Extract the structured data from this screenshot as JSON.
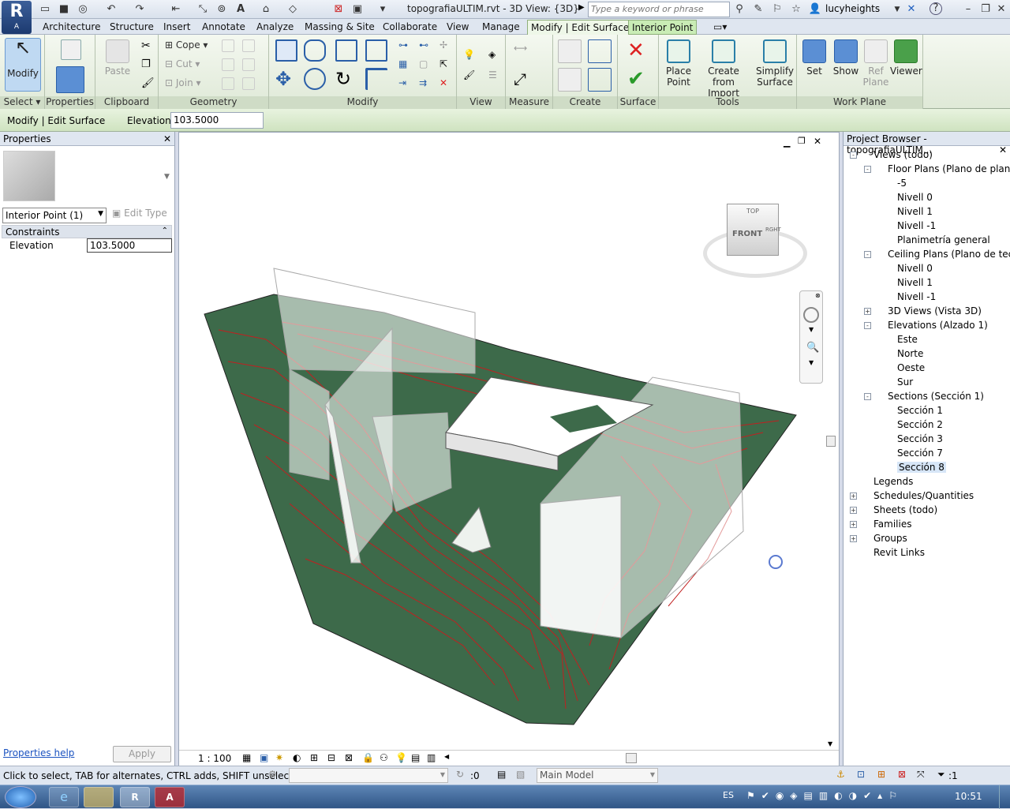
{
  "titlebar": {
    "title": "topografiaULTIM.rvt - 3D View: {3D}",
    "search_placeholder": "Type a keyword or phrase",
    "user": "lucyheights",
    "app_logo": "R",
    "app_logo_sub": "A"
  },
  "menu": {
    "tabs": [
      "Architecture",
      "Structure",
      "Insert",
      "Annotate",
      "Analyze",
      "Massing & Site",
      "Collaborate",
      "View",
      "Manage"
    ],
    "active_tab": "Modify | Edit Surface",
    "context_tab": "Interior Point"
  },
  "ribbon": {
    "panels": {
      "select": "Select",
      "properties": "Properties",
      "clipboard": "Clipboard",
      "geometry": "Geometry",
      "modify": "Modify",
      "view": "View",
      "measure": "Measure",
      "create": "Create",
      "surface": "Surface",
      "tools": "Tools",
      "workplane": "Work Plane"
    },
    "buttons": {
      "modify": "Modify",
      "paste": "Paste",
      "cope": "Cope",
      "cut": "Cut",
      "join": "Join",
      "place_point_1": "Place",
      "place_point_2": "Point",
      "create_import_1": "Create",
      "create_import_2": "from Import",
      "simplify_1": "Simplify",
      "simplify_2": "Surface",
      "set": "Set",
      "show": "Show",
      "ref_plane_1": "Ref",
      "ref_plane_2": "Plane",
      "viewer": "Viewer"
    }
  },
  "optionsbar": {
    "context": "Modify | Edit Surface",
    "elevation_label": "Elevation:",
    "elevation_value": "103.5000"
  },
  "properties": {
    "header": "Properties",
    "type_selector": "Interior Point (1)",
    "edit_type": "Edit Type",
    "group": "Constraints",
    "param_name": "Elevation",
    "param_value": "103.5000",
    "help_link": "Properties help",
    "apply": "Apply"
  },
  "viewcube": {
    "top": "TOP",
    "front": "FRONT",
    "side": "RGHT"
  },
  "viewbar": {
    "scale": "1 : 100"
  },
  "browser": {
    "header": "Project Browser - topografiaULTIM...",
    "items": [
      {
        "label": "Views (todo)",
        "level": 0,
        "box": "-"
      },
      {
        "label": "Floor Plans (Plano de planta)",
        "level": 1,
        "box": "-"
      },
      {
        "label": "-5",
        "level": 2
      },
      {
        "label": "Nivell 0",
        "level": 2
      },
      {
        "label": "Nivell 1",
        "level": 2
      },
      {
        "label": "Nivell -1",
        "level": 2
      },
      {
        "label": "Planimetría general",
        "level": 2
      },
      {
        "label": "Ceiling Plans (Plano de techo)",
        "level": 1,
        "box": "-"
      },
      {
        "label": "Nivell 0",
        "level": 2
      },
      {
        "label": "Nivell 1",
        "level": 2
      },
      {
        "label": "Nivell -1",
        "level": 2
      },
      {
        "label": "3D Views (Vista 3D)",
        "level": 1,
        "box": "+"
      },
      {
        "label": "Elevations (Alzado 1)",
        "level": 1,
        "box": "-"
      },
      {
        "label": "Este",
        "level": 2
      },
      {
        "label": "Norte",
        "level": 2
      },
      {
        "label": "Oeste",
        "level": 2
      },
      {
        "label": "Sur",
        "level": 2
      },
      {
        "label": "Sections (Sección  1)",
        "level": 1,
        "box": "-"
      },
      {
        "label": "Sección 1",
        "level": 2
      },
      {
        "label": "Sección 2",
        "level": 2
      },
      {
        "label": "Sección 3",
        "level": 2
      },
      {
        "label": "Sección 7",
        "level": 2
      },
      {
        "label": "Sección 8",
        "level": 2,
        "selected": true
      },
      {
        "label": "Legends",
        "level": 0
      },
      {
        "label": "Schedules/Quantities",
        "level": 0,
        "box": "+"
      },
      {
        "label": "Sheets (todo)",
        "level": 0,
        "box": "+"
      },
      {
        "label": "Families",
        "level": 0,
        "box": "+"
      },
      {
        "label": "Groups",
        "level": 0,
        "box": "+"
      },
      {
        "label": "Revit Links",
        "level": 0
      }
    ]
  },
  "statusbar": {
    "message": "Click to select, TAB for alternates, CTRL adds, SHIFT unselects.",
    "count": ":0",
    "model": "Main Model",
    "filter_count": ":1"
  },
  "taskbar": {
    "lang": "ES",
    "time": "10:51"
  },
  "colors": {
    "terrain": "#3d6a4a",
    "contour": "#c02020",
    "ribbon_ctx": "#c9ecb5"
  }
}
